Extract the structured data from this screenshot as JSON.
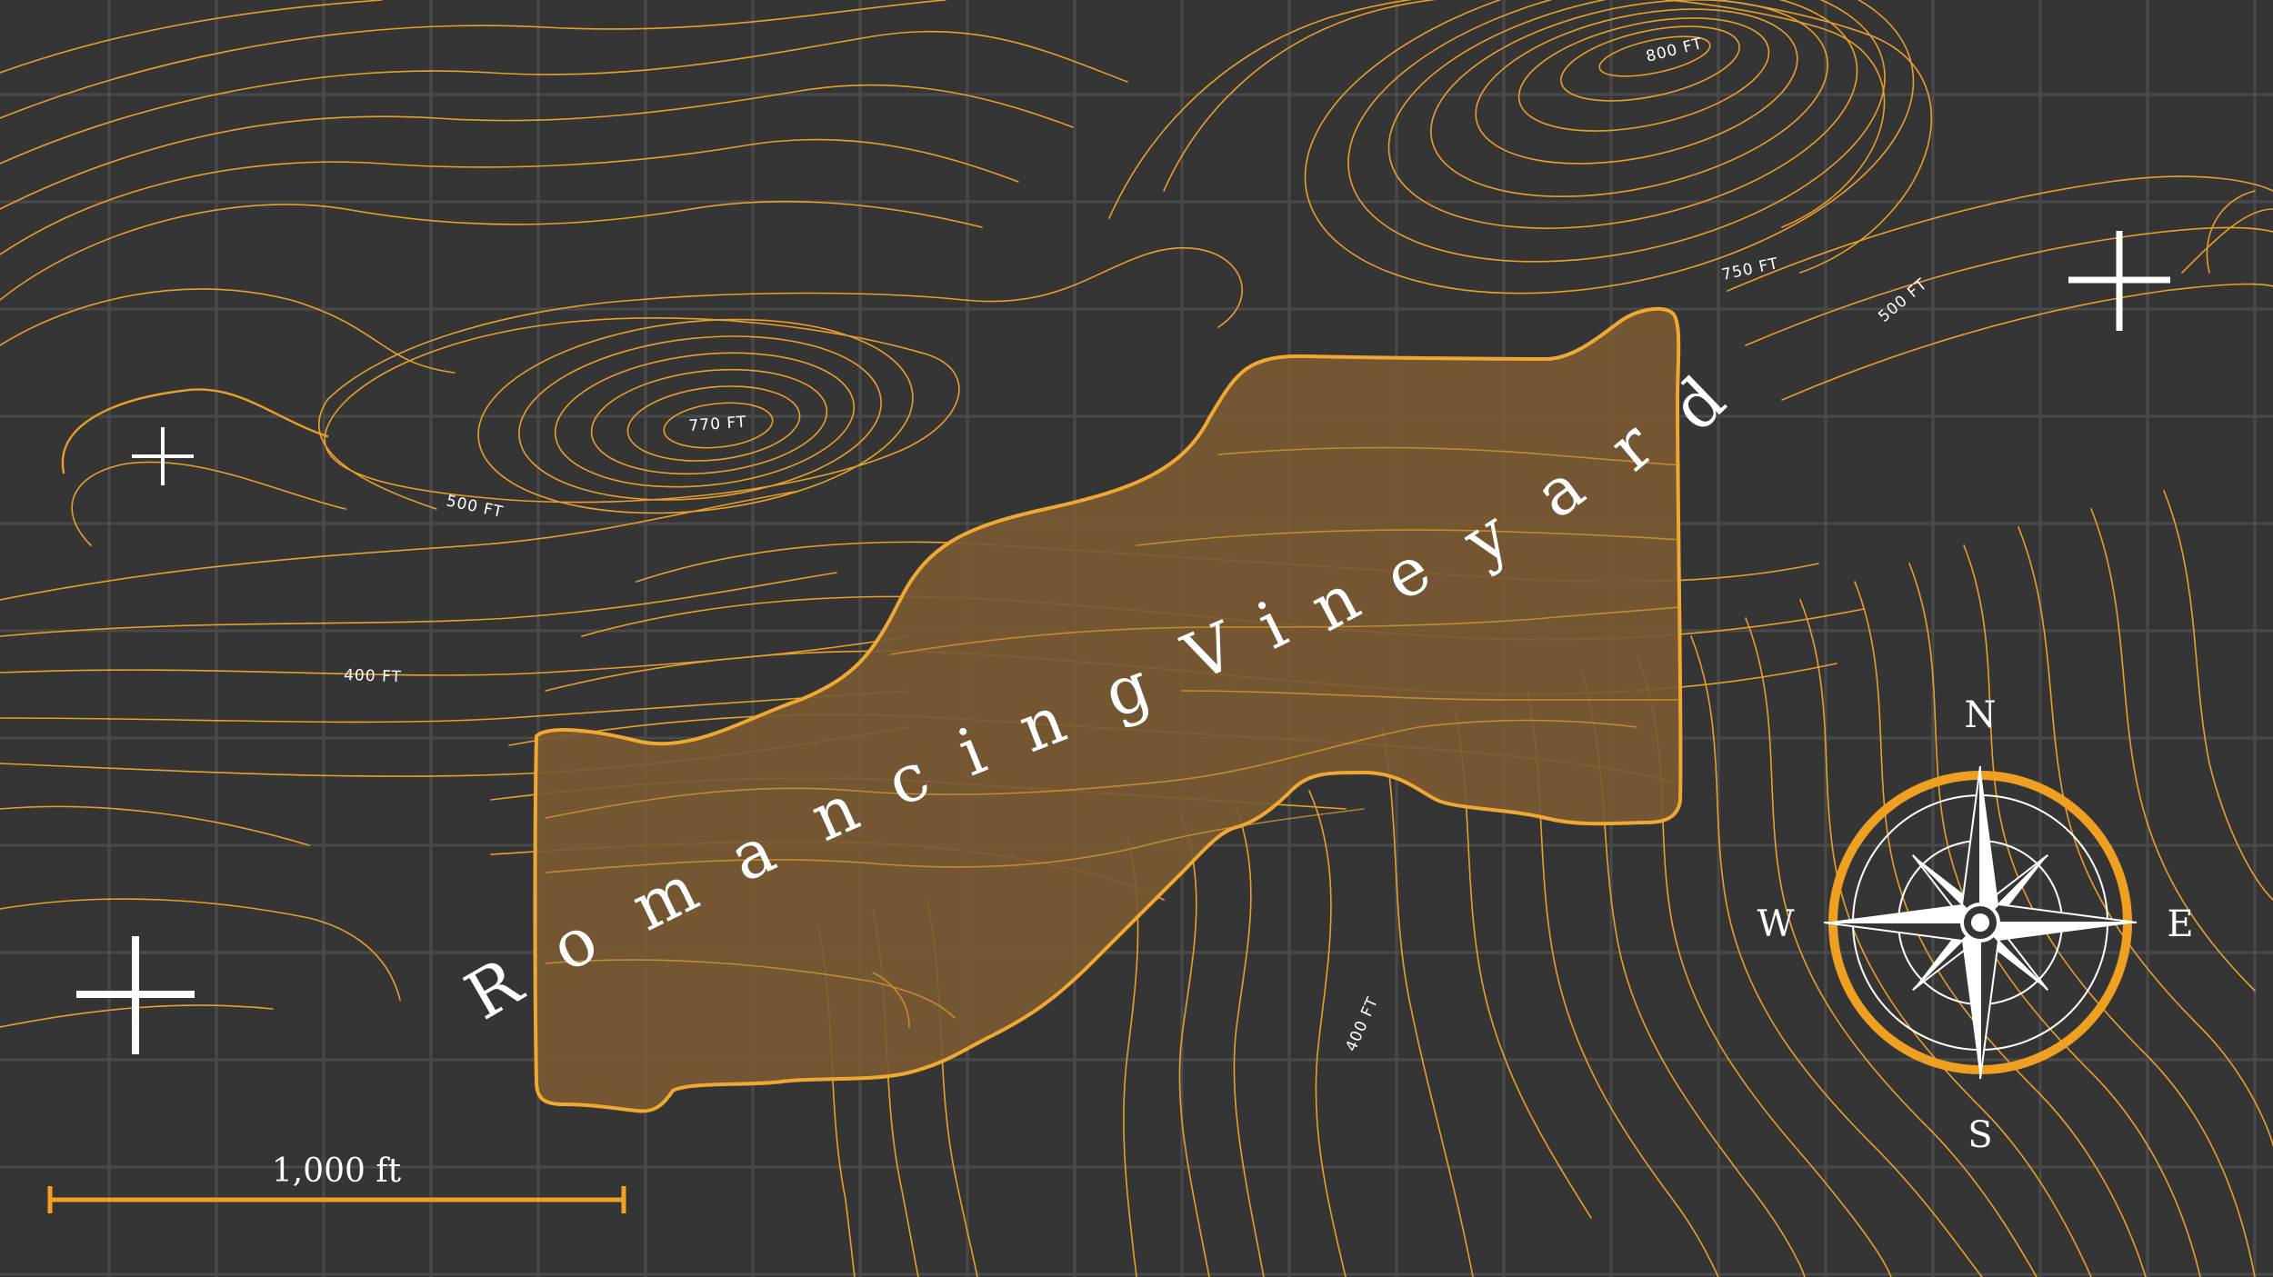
{
  "map": {
    "title": "Romancing Vineyard",
    "colors": {
      "background": "#353535",
      "grid": "#4a4a4a",
      "contour": "#e8a02b",
      "parcel_fill": "#7a5a32",
      "parcel_stroke": "#f0a832",
      "text": "#ffffff"
    },
    "elevation_labels": [
      "800 FT",
      "750 FT",
      "500 FT",
      "770 FT",
      "500 FT",
      "400 FT",
      "400 FT"
    ],
    "compass": {
      "north": "N",
      "south": "S",
      "east": "E",
      "west": "W",
      "icon": "compass-rose-icon"
    },
    "scale_bar": {
      "label": "1,000 ft"
    },
    "markers": [
      "crosshair-icon",
      "crosshair-icon",
      "crosshair-icon"
    ]
  }
}
